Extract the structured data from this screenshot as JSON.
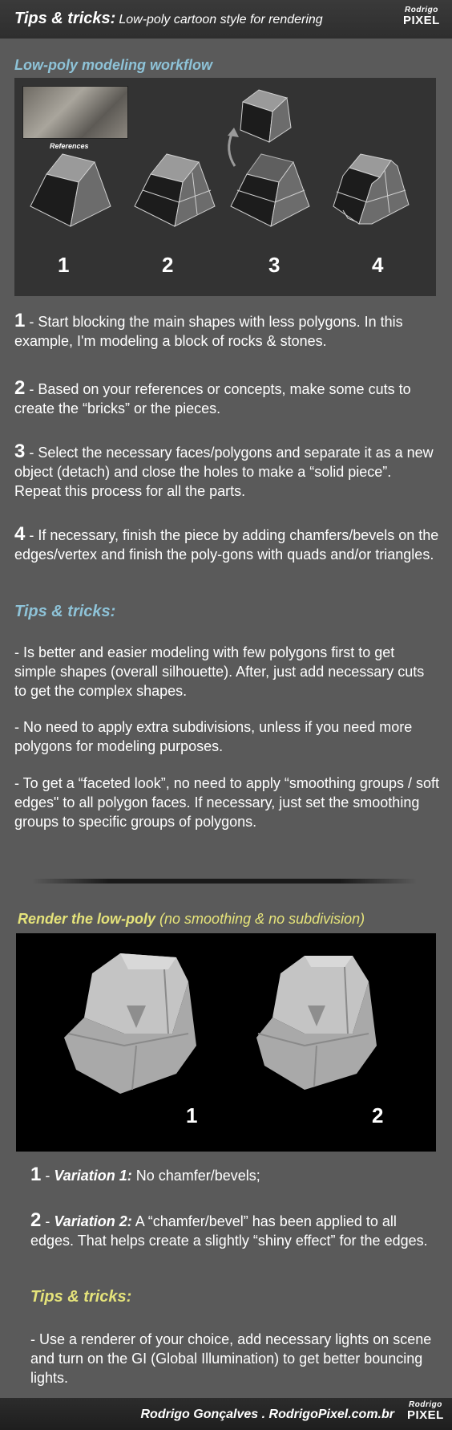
{
  "header": {
    "title": "Tips & tricks:",
    "subtitle": "Low-poly cartoon style for rendering",
    "logo_line1": "Rodrigo",
    "logo_line2": "PIXEL"
  },
  "workflow": {
    "title": "Low-poly modeling workflow",
    "references_label": "References",
    "steps": [
      "1",
      "2",
      "3",
      "4"
    ]
  },
  "steps": [
    {
      "num": "1",
      "text": " - Start blocking the main shapes with less polygons. In this example, I'm modeling a block of rocks & stones."
    },
    {
      "num": "2",
      "text": " - Based on your references or concepts, make some cuts to create the “bricks” or the pieces."
    },
    {
      "num": "3",
      "text": " -  Select the necessary faces/polygons and separate it as a new object (detach) and close the holes to make a “solid piece”. Repeat this process for all the parts."
    },
    {
      "num": "4",
      "text": " - If necessary, finish the piece by adding chamfers/bevels on the edges/vertex and finish the poly-gons with quads and/or triangles."
    }
  ],
  "tips1": {
    "title": "Tips & tricks:",
    "items": [
      "- Is better and easier modeling with few polygons first to get simple shapes (overall silhouette). After, just add necessary cuts to get the complex shapes.",
      "- No need to apply extra subdivisions, unless if you need more polygons for modeling purposes.",
      "- To get a “faceted look”, no need to apply “smoothing groups / soft edges\" to all polygon faces. If necessary, just set the smoothing groups to specific groups of polygons."
    ]
  },
  "render": {
    "title": "Render the low-poly",
    "title_note": "(no smoothing  & no subdivision)",
    "numbers": [
      "1",
      "2"
    ]
  },
  "variations": [
    {
      "num": "1",
      "label": "Variation 1:",
      "text": " No chamfer/bevels;"
    },
    {
      "num": "2",
      "label": "Variation 2:",
      "text": "  A “chamfer/bevel” has been applied to all edges. That helps create a slightly “shiny effect” for the edges."
    }
  ],
  "tips2": {
    "title": "Tips & tricks:",
    "text": "- Use a renderer of your choice, add necessary lights on scene and turn on the GI (Global Illumination) to get better bouncing lights."
  },
  "footer": {
    "credit": "Rodrigo Gonçalves . RodrigoPixel.com.br",
    "logo_line1": "Rodrigo",
    "logo_line2": "PIXEL"
  }
}
